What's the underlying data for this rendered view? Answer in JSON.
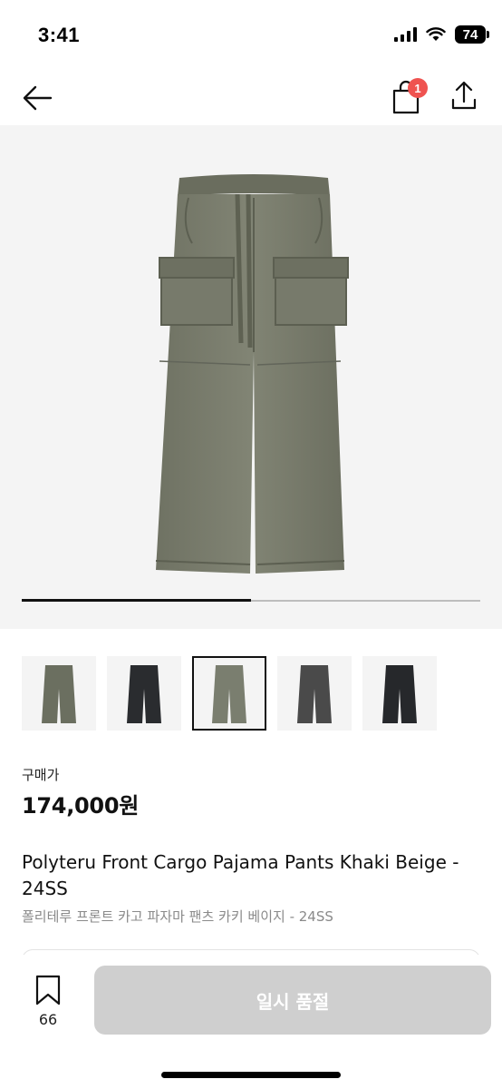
{
  "status_bar": {
    "time": "3:41",
    "battery": "74"
  },
  "header": {
    "cart_count": "1"
  },
  "gallery": {
    "progress_fraction": 0.5,
    "thumbnails": [
      {
        "color": "#6b6f60",
        "selected": false
      },
      {
        "color": "#2a2c2f",
        "selected": false
      },
      {
        "color": "#7a7e6f",
        "selected": true
      },
      {
        "color": "#4a4a4a",
        "selected": false
      },
      {
        "color": "#26282b",
        "selected": false
      }
    ]
  },
  "product": {
    "price_label": "구매가",
    "price": "174,000원",
    "title_en": "Polyteru Front Cargo Pajama Pants Khaki Beige - 24SS",
    "title_ko": "폴리테루 프론트 카고 파자마 팬츠 카키 베이지 - 24SS"
  },
  "footer": {
    "wish_count": "66",
    "buy_button_label": "일시 품절"
  },
  "colors": {
    "badge": "#ef5350",
    "button_disabled": "#cfcfcf",
    "pants_khaki": "#7a7d6e"
  }
}
